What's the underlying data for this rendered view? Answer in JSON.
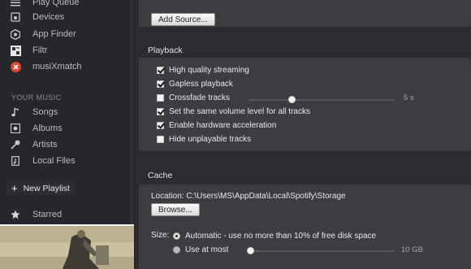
{
  "sidebar": {
    "items_top": [
      {
        "label": "Play Queue",
        "icon": "list-icon"
      },
      {
        "label": "Devices",
        "icon": "speaker-icon"
      },
      {
        "label": "App Finder",
        "icon": "hexagon-icon"
      },
      {
        "label": "Filtr",
        "icon": "app-icon"
      },
      {
        "label": "musiXmatch",
        "icon": "app-icon"
      }
    ],
    "section_heading": "YOUR MUSIC",
    "items_music": [
      {
        "label": "Songs",
        "icon": "note-icon"
      },
      {
        "label": "Albums",
        "icon": "disc-icon"
      },
      {
        "label": "Artists",
        "icon": "microphone-icon"
      },
      {
        "label": "Local Files",
        "icon": "file-icon"
      }
    ],
    "new_playlist": "New Playlist",
    "starred": "Starred"
  },
  "main": {
    "add_source": "Add Source...",
    "playback": {
      "title": "Playback",
      "options": [
        {
          "label": "High quality streaming",
          "checked": true
        },
        {
          "label": "Gapless playback",
          "checked": true
        },
        {
          "label": "Crossfade tracks",
          "checked": false
        },
        {
          "label": "Set the same volume level for all tracks",
          "checked": true
        },
        {
          "label": "Enable hardware acceleration",
          "checked": true
        },
        {
          "label": "Hide unplayable tracks",
          "checked": false
        }
      ],
      "crossfade_value": "5 s",
      "crossfade_level": 0.3
    },
    "cache": {
      "title": "Cache",
      "location": "Location: C:\\Users\\MS\\AppData\\Local\\Spotify\\Storage",
      "browse": "Browse...",
      "size_label": "Size:",
      "radio_auto": "Automatic - use no more than 10% of free disk space",
      "radio_most": "Use at most",
      "size_value": "10 GB"
    }
  }
}
